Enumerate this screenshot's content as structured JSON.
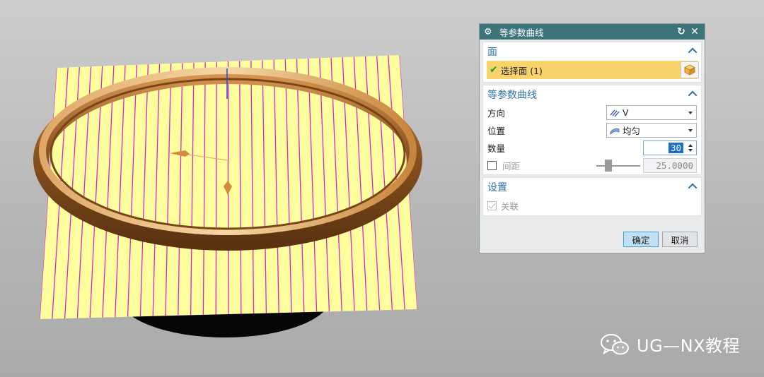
{
  "dialog": {
    "title": "等参数曲线",
    "face_section": {
      "title": "面",
      "select_label": "选择面 (1)"
    },
    "curve_section": {
      "title": "等参数曲线",
      "direction_label": "方向",
      "direction_value": "V",
      "position_label": "位置",
      "position_value": "均匀",
      "count_label": "数量",
      "count_value": "30",
      "spacing_label": "间距",
      "spacing_value": "25.0000"
    },
    "settings_section": {
      "title": "设置",
      "associative_label": "关联"
    },
    "ok_label": "确定",
    "cancel_label": "取消"
  },
  "viewport": {
    "curve_count": 30,
    "colors": {
      "surface": "#ffff99",
      "iso_curve": "#e020d0",
      "ring": "#b06a22",
      "solid": "#000000"
    }
  },
  "watermark": {
    "text": "UG—NX教程"
  }
}
